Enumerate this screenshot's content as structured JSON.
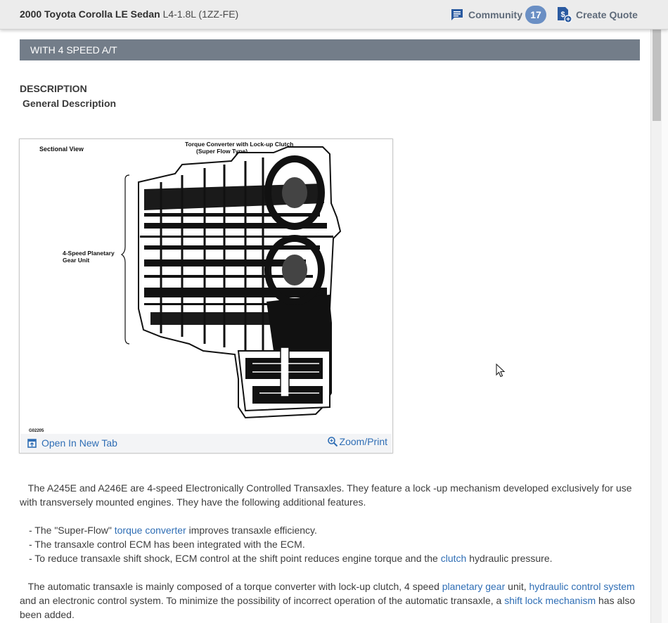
{
  "header": {
    "vehicle_title_bold": "2000 Toyota Corolla LE Sedan",
    "vehicle_engine": "L4-1.8L (1ZZ-FE)",
    "community_label": "Community",
    "community_count": "17",
    "create_quote_label": "Create Quote",
    "icons": {
      "community": "chat-bubble-icon",
      "quote": "dollar-document-plus-icon"
    }
  },
  "section": {
    "title": "WITH 4 SPEED A/T"
  },
  "description": {
    "heading": "DESCRIPTION",
    "subheading": "General Description"
  },
  "figure": {
    "labels": {
      "sectional_view": "Sectional View",
      "torque_converter_line1": "Torque Converter with Lock-up Clutch",
      "torque_converter_line2": "(Super Flow Type)",
      "planetary_line1": "4-Speed Planetary",
      "planetary_line2": "Gear Unit",
      "figure_code": "G02205"
    },
    "open_new_tab_label": "Open In New Tab",
    "zoom_print_label": "Zoom/Print"
  },
  "content": {
    "p1": "The A245E and A246E are 4-speed Electronically Controlled Transaxles. They feature a lock -up mechanism developed exclusively for use with transversely mounted engines. They have the following additional features.",
    "list": [
      {
        "prefix": "-  The \"Super-Flow\" ",
        "link": "torque converter",
        "suffix": " improves transaxle efficiency."
      },
      {
        "prefix": "-  The transaxle control ECM has been integrated with the ECM.",
        "link": "",
        "suffix": ""
      },
      {
        "prefix": "-  To reduce transaxle shift shock, ECM control at the shift point reduces engine torque and the ",
        "link": "clutch",
        "suffix": " hydraulic pressure."
      }
    ],
    "p2": {
      "t1": "The automatic transaxle is mainly composed of a torque converter with lock-up clutch, 4 speed ",
      "l1": "planetary gear",
      "t2": " unit, ",
      "l2": "hydraulic control system",
      "t3": " and an electronic control system. To minimize the possibility of incorrect operation of the automatic transaxle, a ",
      "l3": "shift lock mechanism",
      "t4": " has also been added."
    }
  }
}
